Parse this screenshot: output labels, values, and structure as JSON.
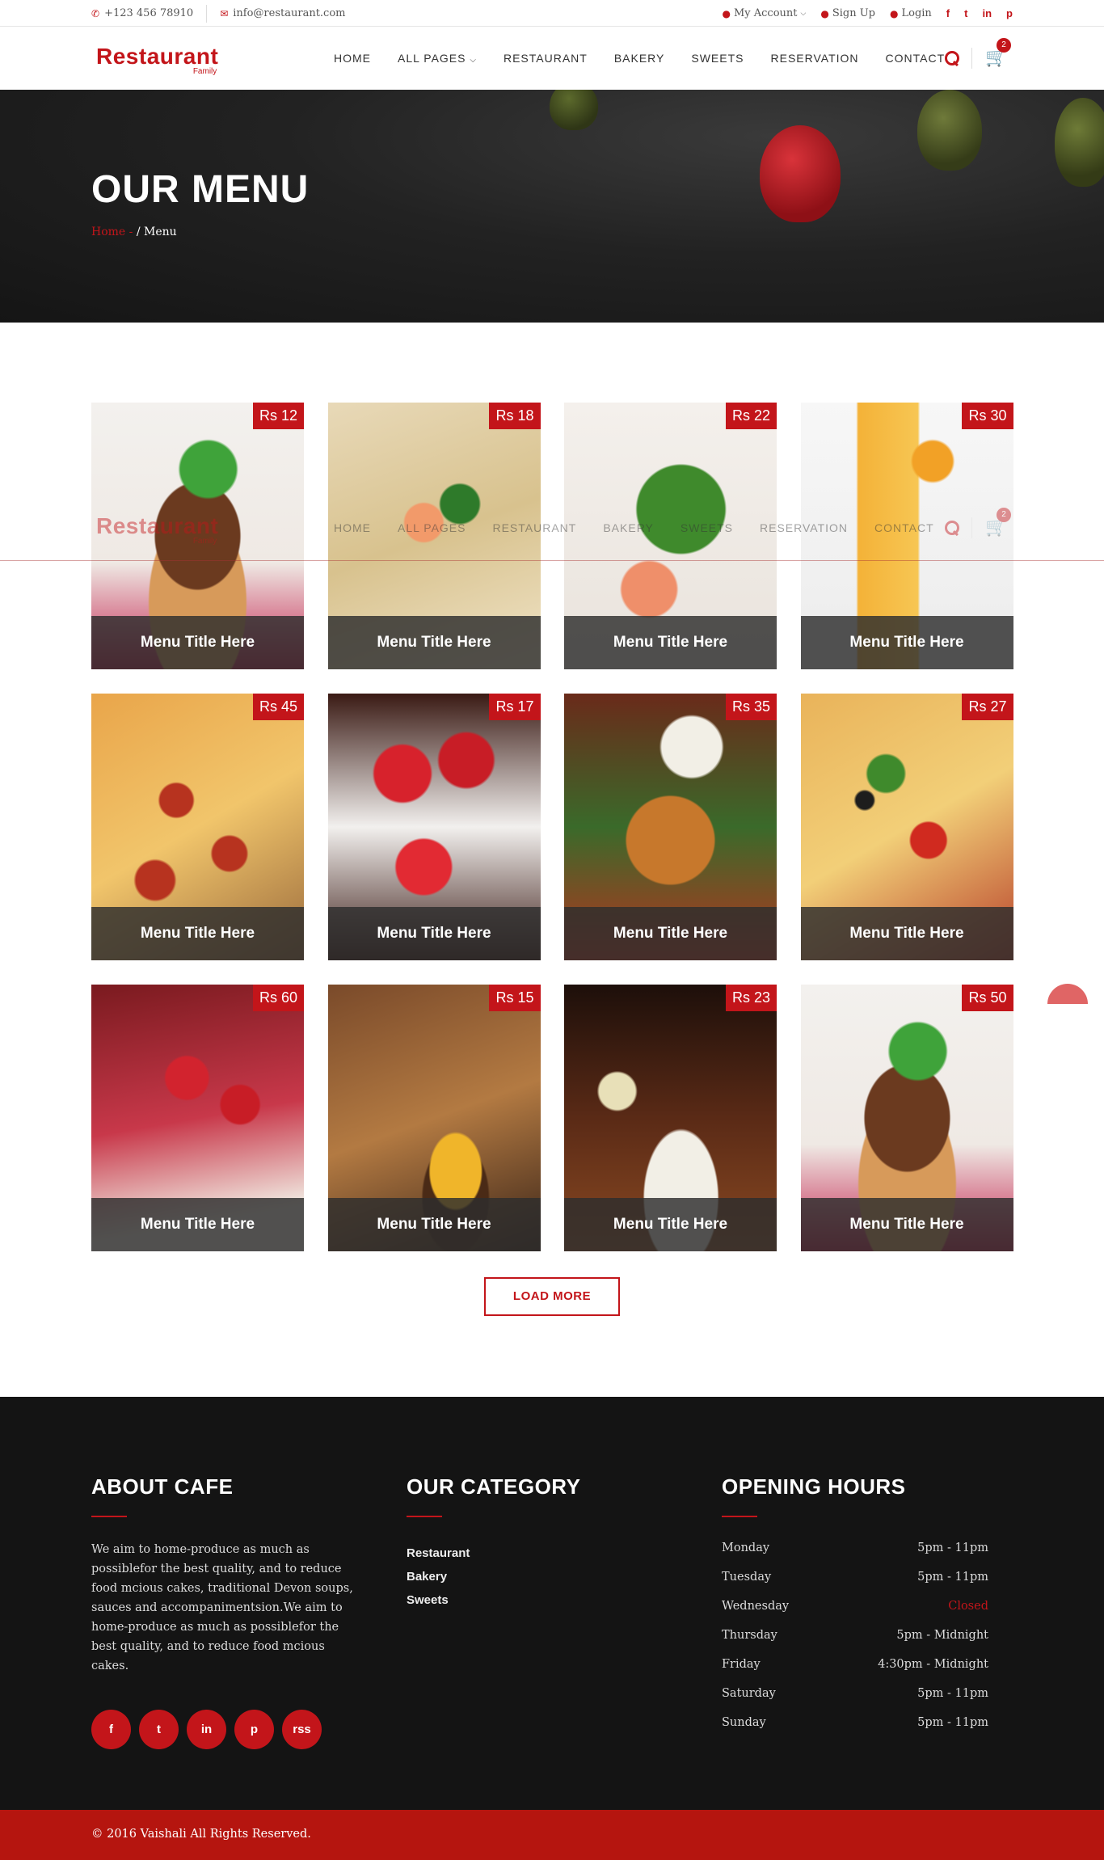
{
  "topbar": {
    "phone": "+123 456 78910",
    "email": "info@restaurant.com",
    "my_account": "My Account",
    "sign_up": "Sign Up",
    "login": "Login",
    "socials": [
      "f",
      "t",
      "in",
      "p"
    ]
  },
  "brand": {
    "name": "Restaurant",
    "tagline": "Family",
    "color": "#c3151a"
  },
  "nav": {
    "items": [
      "HOME",
      "ALL PAGES",
      "RESTAURANT",
      "BAKERY",
      "SWEETS",
      "RESERVATION",
      "CONTACT"
    ],
    "cart_count": "2"
  },
  "banner": {
    "title": "OUR MENU",
    "crumb_home": "Home -",
    "crumb_current": "/ Menu"
  },
  "menu_items": [
    {
      "price": "Rs 12",
      "title": "Menu Title Here",
      "image": "chocolate-cake"
    },
    {
      "price": "Rs 18",
      "title": "Menu Title Here",
      "image": "shrimp-pasta"
    },
    {
      "price": "Rs 22",
      "title": "Menu Title Here",
      "image": "shrimp-salad"
    },
    {
      "price": "Rs 30",
      "title": "Menu Title Here",
      "image": "orange-juice"
    },
    {
      "price": "Rs 45",
      "title": "Menu Title Here",
      "image": "pepperoni-pizza"
    },
    {
      "price": "Rs 17",
      "title": "Menu Title Here",
      "image": "strawberries"
    },
    {
      "price": "Rs 35",
      "title": "Menu Title Here",
      "image": "fried-ball"
    },
    {
      "price": "Rs 27",
      "title": "Menu Title Here",
      "image": "veggie-pizza"
    },
    {
      "price": "Rs 60",
      "title": "Menu Title Here",
      "image": "strawberry-tart"
    },
    {
      "price": "Rs 15",
      "title": "Menu Title Here",
      "image": "burger-fries"
    },
    {
      "price": "Rs 23",
      "title": "Menu Title Here",
      "image": "wine-dinner"
    },
    {
      "price": "Rs 50",
      "title": "Menu Title Here",
      "image": "chocolate-cake"
    }
  ],
  "load_more": "LOAD MORE",
  "footer": {
    "about": {
      "title": "ABOUT CAFE",
      "text": "We aim to home-produce as much as possiblefor the best quality, and to reduce food mcious cakes, traditional Devon soups, sauces and accompanimentsion.We aim to home-produce as much as possiblefor the best quality, and to reduce food mcious cakes."
    },
    "socials": [
      "f",
      "t",
      "in",
      "p",
      "rss"
    ],
    "category": {
      "title": "OUR CATEGORY",
      "items": [
        "Restaurant",
        "Bakery",
        "Sweets"
      ]
    },
    "hours": {
      "title": "OPENING HOURS",
      "rows": [
        {
          "day": "Monday",
          "time": "5pm - 11pm"
        },
        {
          "day": "Tuesday",
          "time": "5pm - 11pm"
        },
        {
          "day": "Wednesday",
          "time": "Closed"
        },
        {
          "day": "Thursday",
          "time": "5pm - Midnight"
        },
        {
          "day": "Friday",
          "time": "4:30pm - Midnight"
        },
        {
          "day": "Saturday",
          "time": "5pm - 11pm"
        },
        {
          "day": "Sunday",
          "time": "5pm - 11pm"
        }
      ]
    }
  },
  "copyright": "© 2016 Vaishali All Rights Reserved."
}
